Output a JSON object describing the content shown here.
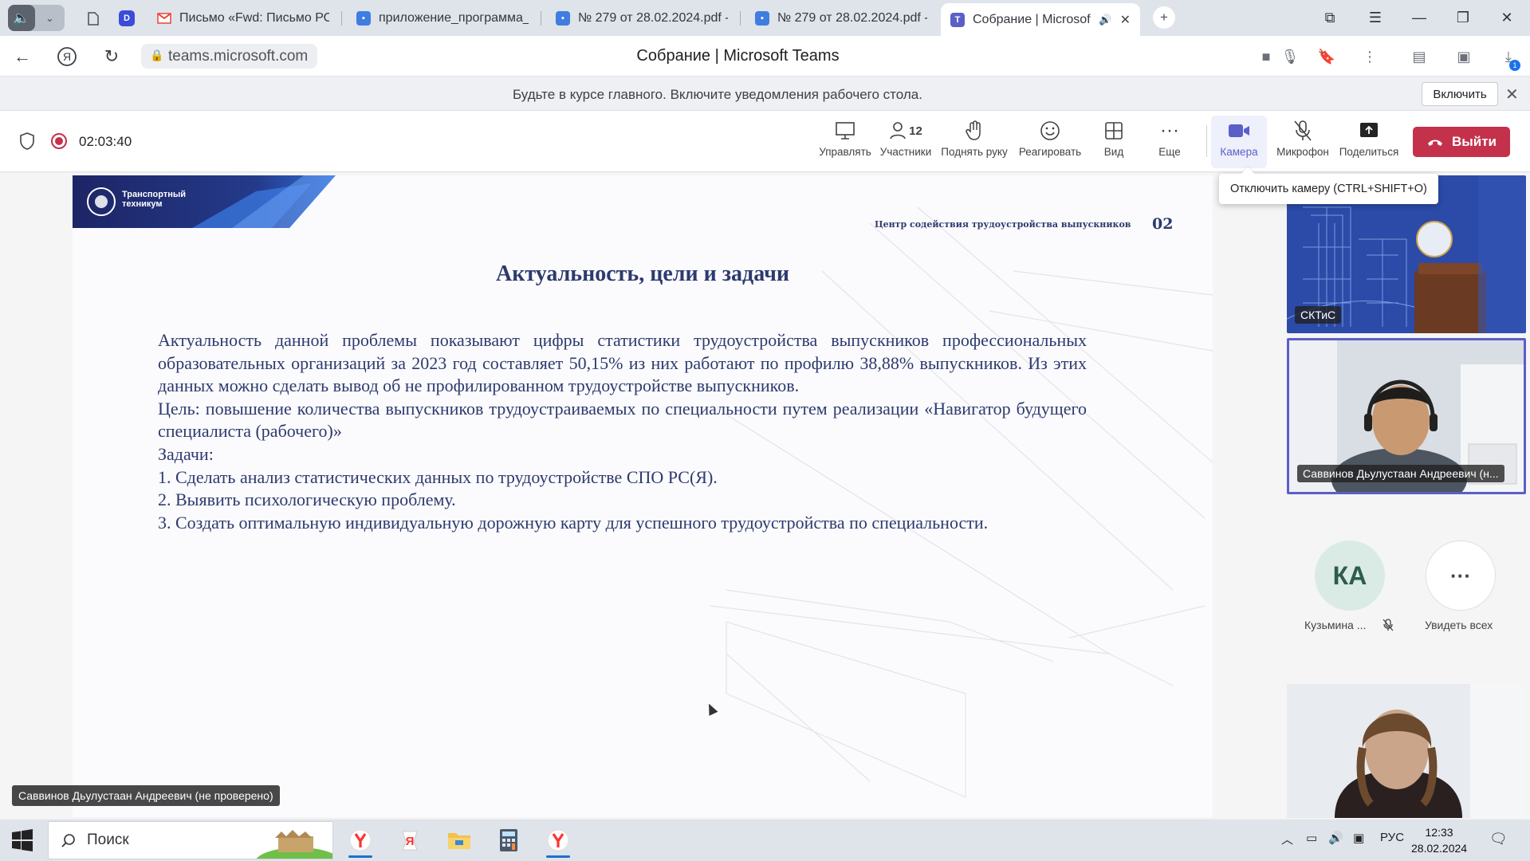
{
  "browser": {
    "tabs": [
      {
        "title": "Письмо «Fwd: Письмо РОЗ",
        "icon": "gmail-icon"
      },
      {
        "title": "приложение_программа_ц",
        "icon": "doc-icon"
      },
      {
        "title": "№ 279 от 28.02.2024.pdf - ",
        "icon": "doc-icon"
      },
      {
        "title": "№ 279 от 28.02.2024.pdf - ",
        "icon": "doc-icon"
      },
      {
        "title": "Собрание | Microsoft",
        "icon": "teams-icon"
      }
    ],
    "url": "teams.microsoft.com",
    "page_title": "Собрание | Microsoft Teams",
    "downloads_badge": "1"
  },
  "notification": {
    "message": "Будьте в курсе главного. Включите уведомления рабочего стола.",
    "enable_label": "Включить"
  },
  "meeting": {
    "timer": "02:03:40",
    "participants_count": "12",
    "tools": {
      "manage": "Управлять",
      "participants": "Участники",
      "raise_hand": "Поднять руку",
      "react": "Реагировать",
      "view": "Вид",
      "more": "Еще",
      "camera": "Камера",
      "mic": "Микрофон",
      "share": "Поделиться"
    },
    "leave_label": "Выйти",
    "tooltip": "Отключить камеру (CTRL+SHIFT+O)"
  },
  "slide": {
    "logo_line1": "Транспортный",
    "logo_line2": "техникум",
    "center_label": "Центр содействия трудоустройства выпускников",
    "page_number": "02",
    "title": "Актуальность, цели и задачи",
    "paragraph1": "Актуальность данной проблемы  показывают цифры статистики трудоустройства выпускников профессиональных образовательных организаций за 2023 год составляет 50,15% из них работают по профилю 38,88% выпускников. Из этих данных можно сделать вывод об не профилированном трудоустройстве выпускников.",
    "paragraph2": "Цель: повышение количества выпускников трудоустраиваемых по специальности путем реализации «Навигатор будущего специалиста (рабочего)»",
    "tasks_label": "Задачи:",
    "task1": "1. Сделать анализ статистических данных по трудоустройстве СПО РС(Я).",
    "task2": "2. Выявить психологическую проблему.",
    "task3": "3. Создать оптимальную индивидуальную дорожную карту для успешного трудоустройства по специальности."
  },
  "participants": {
    "video1_name": "СКТиС",
    "video2_name": "Саввинов Дьулустаан Андреевич (н...",
    "avatar_initials": "КА",
    "avatar_name": "Кузьмина ...",
    "see_all_label": "Увидеть всех",
    "speaker_tag": "Саввинов Дьулустаан Андреевич (не проверено)"
  },
  "taskbar": {
    "search_placeholder": "Поиск",
    "language": "РУС",
    "time": "12:33",
    "date": "28.02.2024"
  },
  "colors": {
    "teams_accent": "#5b5fc7",
    "leave_red": "#c4314b",
    "slide_navy": "#2d3a6e"
  }
}
